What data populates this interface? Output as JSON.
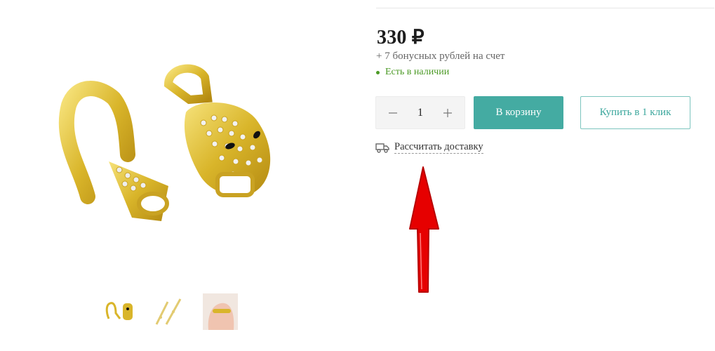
{
  "product": {
    "price": "330 ₽",
    "bonus_text": "+ 7 бонусных рублей на счет",
    "stock_text": "Есть в наличии",
    "quantity": "1"
  },
  "actions": {
    "decrease_symbol": "−",
    "increase_symbol": "+",
    "cart_label": "В корзину",
    "one_click_label": "Купить в 1 клик",
    "delivery_label": "Рассчитать доставку"
  },
  "thumbnails": [
    "thumb-clasp-pair",
    "thumb-clasp-open",
    "thumb-clasp-on-hand"
  ],
  "colors": {
    "accent": "#44aba2",
    "stock_green": "#4c9a26",
    "gold": "#d9b52a",
    "annotation_red": "#e60000"
  },
  "icons": {
    "delivery": "truck-icon",
    "annotation": "red-arrow-up-icon"
  }
}
